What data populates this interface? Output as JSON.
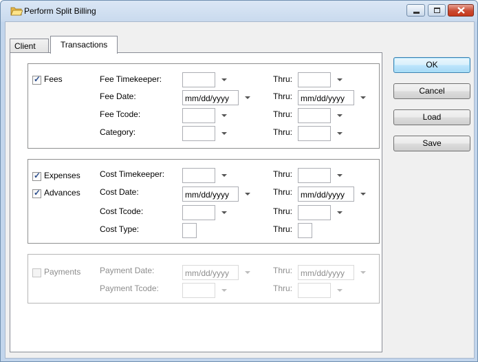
{
  "window": {
    "title": "Perform Split Billing"
  },
  "tabs": [
    {
      "label": "Client",
      "active": false
    },
    {
      "label": "Transactions",
      "active": true
    }
  ],
  "fees": {
    "checkbox_label": "Fees",
    "checked": true,
    "timekeeper_label": "Fee Timekeeper:",
    "timekeeper_value": "",
    "date_label": "Fee Date:",
    "date_value": "mm/dd/yyyy",
    "tcode_label": "Fee Tcode:",
    "tcode_value": "",
    "category_label": "Category:",
    "category_value": "",
    "thru_label": "Thru:",
    "thru_date_value": "mm/dd/yyyy"
  },
  "costs": {
    "expenses_label": "Expenses",
    "expenses_checked": true,
    "advances_label": "Advances",
    "advances_checked": true,
    "timekeeper_label": "Cost Timekeeper:",
    "date_label": "Cost Date:",
    "date_value": "mm/dd/yyyy",
    "tcode_label": "Cost Tcode:",
    "type_label": "Cost Type:",
    "thru_label": "Thru:",
    "thru_date_value": "mm/dd/yyyy"
  },
  "payments": {
    "checkbox_label": "Payments",
    "checked": false,
    "enabled": false,
    "date_label": "Payment Date:",
    "date_value": "mm/dd/yyyy",
    "tcode_label": "Payment Tcode:",
    "thru_label": "Thru:",
    "thru_date_value": "mm/dd/yyyy"
  },
  "buttons": {
    "ok": "OK",
    "cancel": "Cancel",
    "load": "Load",
    "save": "Save"
  },
  "icons": {
    "title": "folder-icon",
    "minimize": "minimize-icon",
    "maximize": "maximize-icon",
    "close": "close-icon",
    "dropdown": "chevron-down-icon"
  },
  "colors": {
    "titlebar": "#c2d5ec",
    "close_button": "#c7381b",
    "default_button": "#a7d9f5",
    "disabled_text": "#8d8d8d"
  }
}
